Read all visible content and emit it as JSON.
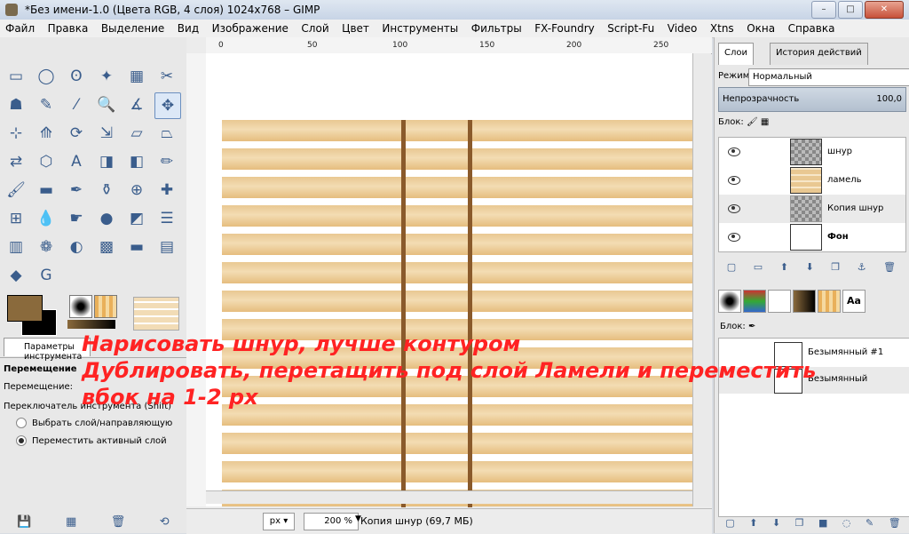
{
  "window": {
    "title": "*Без имени-1.0 (Цвета RGB, 4 слоя) 1024x768 – GIMP",
    "minimize": "–",
    "maximize": "□",
    "close": "✕"
  },
  "menu": [
    "Файл",
    "Правка",
    "Выделение",
    "Вид",
    "Изображение",
    "Слой",
    "Цвет",
    "Инструменты",
    "Фильтры",
    "FX-Foundry",
    "Script-Fu",
    "Video",
    "Xtns",
    "Окна",
    "Справка"
  ],
  "toolbox": {
    "tools": [
      "rect-select",
      "ellipse-select",
      "free-select",
      "fuzzy-select",
      "by-color-select",
      "scissors",
      "foreground-select",
      "paths",
      "color-picker",
      "zoom",
      "measure",
      "move",
      "align",
      "crop",
      "rotate",
      "scale",
      "shear",
      "perspective",
      "flip",
      "cage",
      "text",
      "bucket-fill",
      "blend",
      "pencil",
      "paintbrush",
      "eraser",
      "airbrush",
      "ink",
      "clone",
      "heal",
      "perspective-clone",
      "blur",
      "smudge",
      "dodge-burn",
      "script-a",
      "script-b",
      "script-c",
      "script-d",
      "script-e",
      "script-f",
      "script-g",
      "script-h",
      "gegl",
      "gimp-logo"
    ],
    "options_tab": "Параметры инструмента",
    "move_title": "Перемещение",
    "move_label": "Перемещение:",
    "switch_label": "Переключатель инструмента  (Shift)",
    "radio_1": "Выбрать слой/направляющую",
    "radio_2": "Переместить активный слой"
  },
  "canvas": {
    "ruler_ticks": [
      "0",
      "50",
      "100",
      "150",
      "200",
      "250"
    ],
    "unit": "px ▾",
    "zoom": "200 %",
    "zoom_arrow": "▼",
    "status": "Копия шнур (69,7 МБ)"
  },
  "layers_panel": {
    "tab_layers": "Слои",
    "tab_history": "История действий",
    "mode_label": "Режим:",
    "mode_value": "Нормальный",
    "opacity_label": "Непрозрачность",
    "opacity_value": "100,0",
    "lock_label": "Блок:",
    "layers": [
      {
        "name": "шнур",
        "bold": false,
        "selected": false
      },
      {
        "name": "ламель",
        "bold": false,
        "selected": false
      },
      {
        "name": "Копия шнур",
        "bold": false,
        "selected": true
      },
      {
        "name": "Фон",
        "bold": true,
        "selected": false
      }
    ]
  },
  "paths_panel": {
    "lock_label": "Блок:",
    "aa_label": "Aa",
    "paths": [
      {
        "name": "Безымянный #1",
        "selected": false
      },
      {
        "name": "Безымянный",
        "selected": true
      }
    ]
  },
  "overlay": {
    "line1": "Нарисовать шнур, лучше контуром",
    "line2": "Дублировать, перетащить под слой Ламели и переместить",
    "line3": "вбок на 1-2 px"
  },
  "colors": {
    "foreground": "#8a6a3c",
    "background": "#000000",
    "slat": "#e9c892",
    "cord": "#8a5a2b",
    "overlay_text": "#ff2323"
  }
}
